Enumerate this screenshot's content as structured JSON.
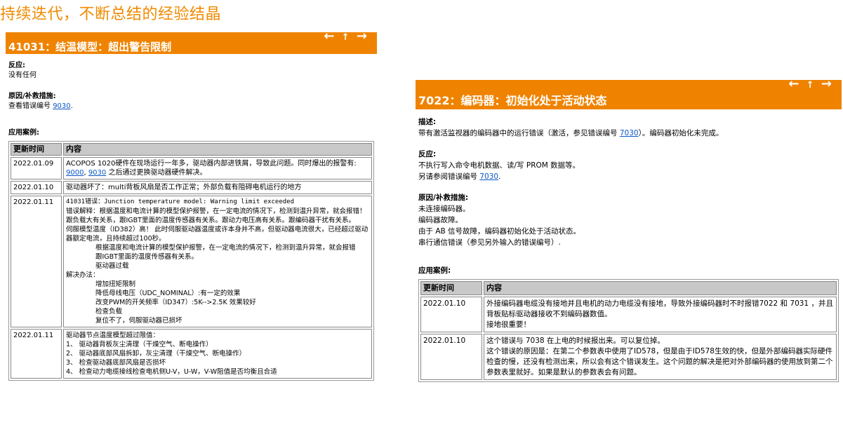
{
  "headline": "持续迭代，不断总结的经验结晶",
  "nav": {
    "prev": "←",
    "up": "↑",
    "next": "→"
  },
  "left": {
    "title": "41031：结温模型：超出警告限制",
    "reaction_label": "反应:",
    "reaction_text": "没有任何",
    "cause_label": "原因/补救措施:",
    "cause_text": "查看错误编号",
    "cause_link": "9030",
    "cause_end": ".",
    "cases_label": "应用案例:",
    "th_date": "更新时间",
    "th_content": "内容",
    "rows": [
      {
        "date": "2022.01.09",
        "l1": "ACOPOS 1020硬件在现场运行一年多，驱动器内部进铁屑，导致此问题。同时爆出的报警有:",
        "link1": "9000",
        "sep": ", ",
        "link2": "9030",
        "l2": " 之后通过更换驱动器硬件解决。"
      },
      {
        "date": "2022.01.10",
        "l1": "驱动器坏了：multi背板风扇是否工作正常；外部负载有阻碍电机运行的地方"
      },
      {
        "date": "2022.01.11",
        "lines": [
          "41031错误：Junction temperature model: Warning limit exceeded",
          "错误解释：根据温度和电流计算的模型保护报警，在一定电流的情况下，检测到温升异常，就会报错！跟负载大有关系，跟IGBT里面的温度传感器有关系。跟动力电压高有关系。跟编码器干扰有关系。",
          "伺服模型温度（ID382）高！ 此时伺服驱动器温度或许本身并不高，但驱动器电流很大，已经超过驱动器额定电流，且持续超过100秒。"
        ],
        "ind_line": "根据温度和电流计算的模型保护报警，在一定电流的情况下，检测到温升异常，就会报错",
        "ind_items": [
          "跟IGBT里面的温度传感器有关系。",
          "驱动器过载"
        ],
        "solution_label": "解决办法：",
        "solutions": [
          "增加扭矩限制",
          "降低母线电压（UDC_NOMINAL）:有一定的效果",
          "改变PWM的开关频率（ID347）:5K-->2.5K 效果较好",
          "检查负载",
          "复位不了，伺服驱动器已损坏"
        ]
      },
      {
        "date": "2022.01.11",
        "head": "驱动器节点温度模型超过限值：",
        "items": [
          "1、 驱动器背板灰尘清理（干燥空气、断电操作）",
          "2、 驱动器底部风扇拆卸，灰尘清理（干燥空气、断电操作）",
          "3、 检查驱动器底部风扇是否损坏",
          "4、 检查动力电缆接线检查电机侧U-V，U-W，V-W阻值是否均衡且合适"
        ]
      }
    ]
  },
  "right": {
    "title": "7022：编码器：初始化处于活动状态",
    "desc_label": "描述:",
    "desc_a": "带有激活监视器的编码器中的运行错误（激活，参见错误编号",
    "desc_link": "7030",
    "desc_b": "）。编码器初始化未完成。",
    "reaction_label": "反应:",
    "reaction_1": "不执行写入命令电机数据、读/写 PROM 数据等。",
    "reaction_2a": "另请参阅错误编号",
    "reaction_link": "7030",
    "reaction_2b": ".",
    "cause_label": "原因/补救措施:",
    "causes": [
      "未连接编码器。",
      "编码器故障。",
      "由于 AB 信号故障，编码器初始化处于活动状态。",
      "串行通信错误（参见另外输入的错误编号）."
    ],
    "cases_label": "应用案例:",
    "th_date": "更新时间",
    "th_content": "内容",
    "rows": [
      {
        "date": "2022.01.10",
        "l1": "外接编码器电缆没有接地并且电机的动力电缆没有接地，导致外接编码器时不时报错7022 和 7031 ，并且背板贴标驱动器接收不到编码器数值。",
        "l2": "接地很重要！"
      },
      {
        "date": "2022.01.10",
        "l1": "这个错误与 7038 在上电的时候报出来。可以复位掉。",
        "l2": "这个错误的原因是：在第二个参数表中使用了ID578，但是由于ID578生效的快，但是外部编码器实际硬件检查的慢，还没有检测出来，所以会有这个错误发生。这个问题的解决是把对外部编码器的使用放到第二个参数表里就好。如果是默认的参数表会有问题。"
      }
    ]
  }
}
